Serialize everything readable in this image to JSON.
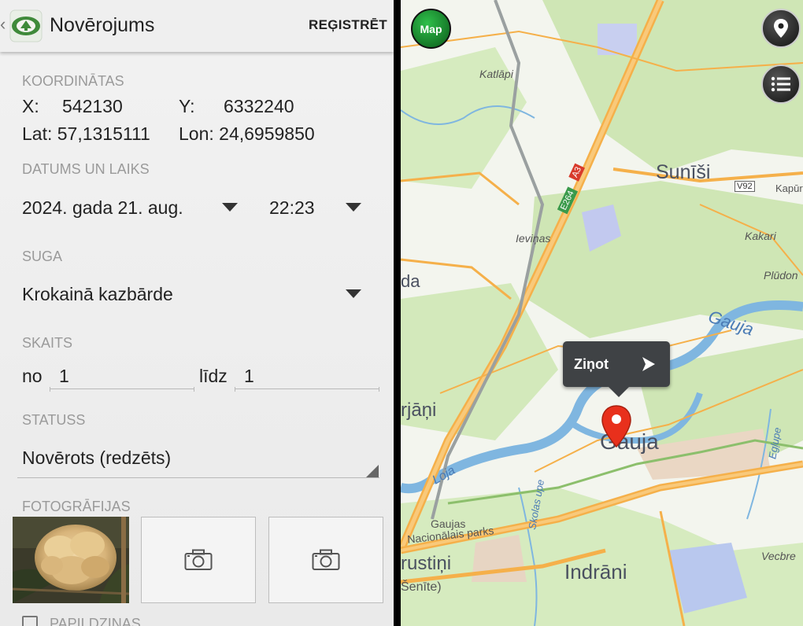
{
  "appbar": {
    "back_glyph": "‹",
    "title": "Novērojums",
    "action": "REĢISTRĒT",
    "icon": "eye-leaf-app-icon"
  },
  "coords": {
    "section": "KOORDINĀTAS",
    "x_label": "X:",
    "x_value": "542130",
    "y_label": "Y:",
    "y_value": "6332240",
    "lat_text": "Lat: 57,1315111",
    "lon_text": "Lon: 24,6959850"
  },
  "datetime": {
    "section": "DATUMS UN LAIKS",
    "date": "2024. gada 21. aug.",
    "time": "22:23"
  },
  "species": {
    "section": "SUGA",
    "value": "Krokainā kazbārde"
  },
  "count": {
    "section": "SKAITS",
    "from_label": "no",
    "from_value": "1",
    "to_label": "līdz",
    "to_value": "1"
  },
  "status": {
    "section": "STATUSS",
    "value": "Novērots (redzēts)"
  },
  "photos": {
    "section": "FOTOGRĀFIJAS",
    "slots": [
      "fungus-photo",
      "camera-icon",
      "camera-icon"
    ]
  },
  "extra": {
    "label": "PAPILDZINAS"
  },
  "map": {
    "map_button": "Map",
    "popup_label": "Ziņot",
    "places": {
      "katlapi": "Katlāpi",
      "sunisi": "Sunīši",
      "kapur": "Kapūr",
      "kakari": "Kakari",
      "pludon": "Plūdon",
      "ievinas": "Ieviņas",
      "gauja_river": "Gauja",
      "gauja_town": "Gauja",
      "egupe": "Egļupe",
      "loja": "Loja",
      "skolas_upe": "Skolas upe",
      "gaujas": "Gaujas",
      "nacionalais": "Nacionālais parks",
      "rustini": "rustiņi",
      "indrani": "Indrāni",
      "senite": "Šenīte)",
      "vecbre": "Vecbre",
      "rjani": "rjāņi",
      "da": "da",
      "road_a3": "A3",
      "road_e264": "E264",
      "road_v92": "V92"
    },
    "colors": {
      "forest": "#cfe6b5",
      "road": "#f5b04a",
      "river": "#7fb6e0",
      "pin": "#e8301c"
    }
  }
}
